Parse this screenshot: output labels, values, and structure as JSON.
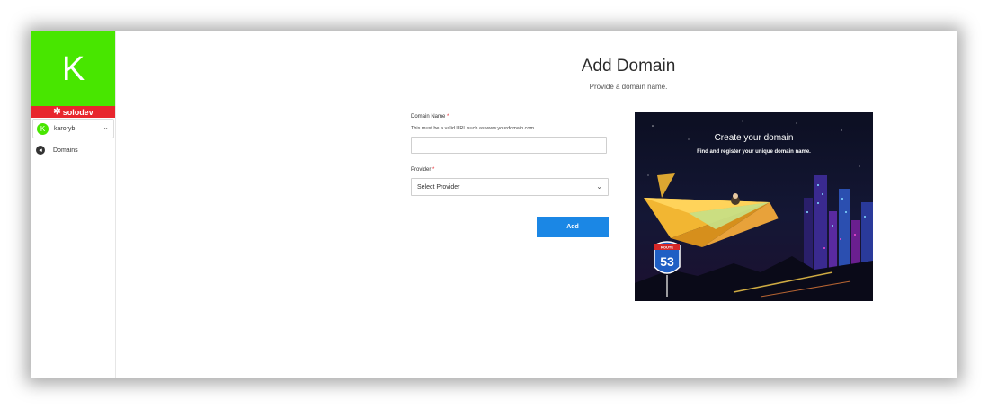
{
  "sidebar": {
    "brand_letter": "K",
    "brand_name": "solodev",
    "user": {
      "initial": "K",
      "name": "karoryb"
    },
    "nav": [
      {
        "label": "Domains"
      }
    ]
  },
  "page": {
    "title": "Add Domain",
    "subtitle": "Provide a domain name."
  },
  "form": {
    "domain_name_label": "Domain Name",
    "required_mark": "*",
    "domain_helper": "This must be a valid URL such as www.yourdomain.com",
    "domain_value": "",
    "provider_label": "Provider",
    "provider_selected": "Select Provider",
    "add_label": "Add"
  },
  "promo": {
    "title": "Create your domain",
    "subtitle": "Find and register your unique domain name.",
    "sign_top": "ROUTE",
    "sign_number": "53"
  },
  "colors": {
    "brand_green": "#48e600",
    "brand_red": "#e8262d",
    "primary_blue": "#1b87e5"
  }
}
